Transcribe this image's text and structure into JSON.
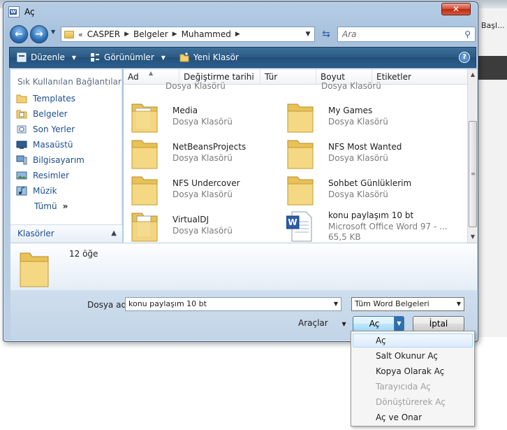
{
  "window": {
    "title": "Aç",
    "close_label": "✕"
  },
  "address": {
    "crumbs": [
      "CASPER",
      "Belgeler",
      "Muhammed"
    ],
    "root_glyph": "«"
  },
  "search": {
    "placeholder": "Ara"
  },
  "toolbar": {
    "organize": "Düzenle",
    "views": "Görünümler",
    "new_folder": "Yeni Klasör"
  },
  "nav_pane": {
    "title": "Sık Kullanılan Bağlantılar",
    "items": [
      "Templates",
      "Belgeler",
      "Son Yerler",
      "Masaüstü",
      "Bilgisayarım",
      "Resimler",
      "Müzik"
    ],
    "more": "Tümü",
    "more_glyph": "»",
    "folders_label": "Klasörler"
  },
  "columns": [
    "Ad",
    "Değiştirme tarihi",
    "Tür",
    "Boyut",
    "Etiketler"
  ],
  "files": {
    "partial_left_type": "Dosya Klasörü",
    "partial_right_type": "Dosya Klasörü",
    "items": [
      {
        "name": "Media",
        "type": "Dosya Klasörü"
      },
      {
        "name": "My Games",
        "type": "Dosya Klasörü"
      },
      {
        "name": "NetBeansProjects",
        "type": "Dosya Klasörü"
      },
      {
        "name": "NFS Most Wanted",
        "type": "Dosya Klasörü"
      },
      {
        "name": "NFS Undercover",
        "type": "Dosya Klasörü"
      },
      {
        "name": "Sohbet Günlüklerim",
        "type": "Dosya Klasörü"
      },
      {
        "name": "VirtualDJ",
        "type": "Dosya Klasörü"
      },
      {
        "name": "konu paylaşım 10 bt",
        "type": "Microsoft Office Word 97 - ...",
        "size": "65,5 KB"
      }
    ]
  },
  "details": {
    "count": "12 öğe"
  },
  "bottom": {
    "filename_label": "Dosya adı:",
    "filename_value": "konu paylaşım 10 bt",
    "filetype_value": "Tüm Word Belgeleri",
    "tools_label": "Araçlar",
    "open_label": "Aç",
    "cancel_label": "İptal"
  },
  "menu": {
    "items": [
      {
        "label": "Aç",
        "state": "highlighted"
      },
      {
        "label": "Salt Okunur Aç",
        "state": "enabled"
      },
      {
        "label": "Kopya Olarak Aç",
        "state": "enabled"
      },
      {
        "label": "Tarayıcıda Aç",
        "state": "disabled"
      },
      {
        "label": "Dönüştürerek Aç",
        "state": "disabled"
      },
      {
        "label": "Aç ve Onar",
        "state": "enabled"
      }
    ]
  },
  "background": {
    "partial_text": "Başl..."
  },
  "colors": {
    "link": "#1b4e8f",
    "toolbar": "#2b5a85",
    "accent": "#3c7fb1",
    "close": "#d2492f"
  }
}
